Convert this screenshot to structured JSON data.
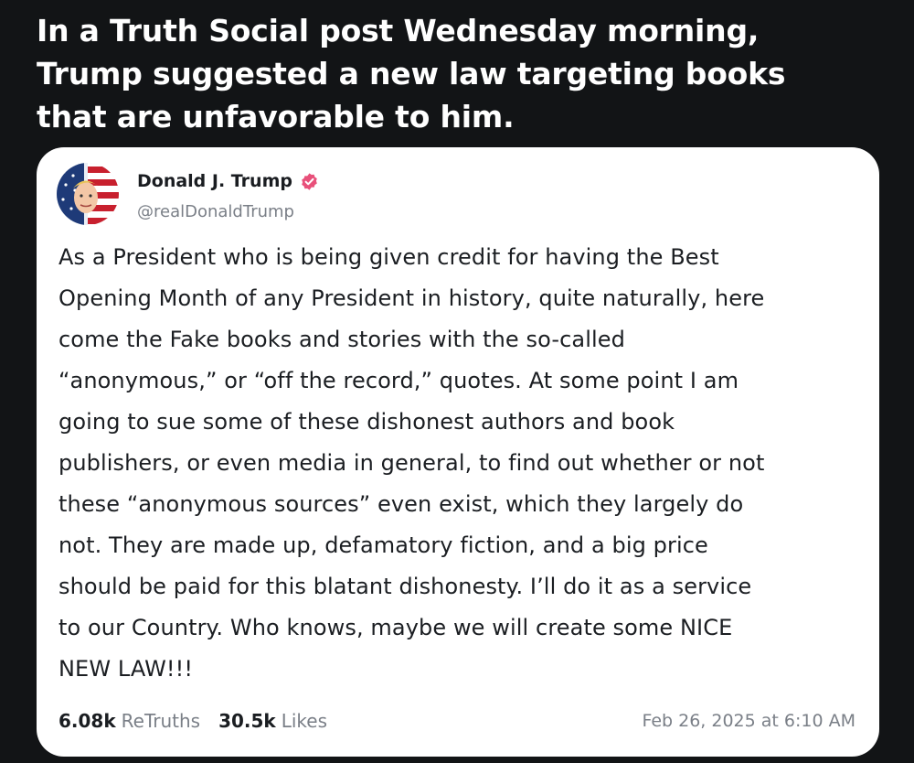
{
  "headline": {
    "lines": [
      "In a Truth Social post Wednesday morning,",
      "Trump suggested a new law targeting books",
      "that are unfavorable to him."
    ]
  },
  "post": {
    "author": {
      "display_name": "Donald J. Trump",
      "handle": "@realDonaldTrump",
      "verified_icon": "verified-badge-icon",
      "verified_color": "#e8507a",
      "avatar_icon": "profile-avatar"
    },
    "text_lines": [
      "As a President who is being given credit for having the Best",
      "Opening Month of any President in history, quite naturally, here",
      "come the Fake books and stories with the so-called",
      "“anonymous,” or “off the record,” quotes. At some point I am",
      "going to sue some of these dishonest authors and book",
      "publishers, or even media in general, to find out whether or not",
      "these “anonymous sources” even exist, which they largely do",
      "not. They are made up, defamatory fiction, and a big price",
      "should be paid for this blatant dishonesty. I’ll do it as a service",
      "to our Country. Who knows, maybe we will create some NICE",
      "NEW LAW!!!"
    ],
    "stats": {
      "retruths_count": "6.08k",
      "retruths_label": "ReTruths",
      "likes_count": "30.5k",
      "likes_label": "Likes"
    },
    "timestamp": "Feb 26, 2025 at 6:10 AM"
  }
}
